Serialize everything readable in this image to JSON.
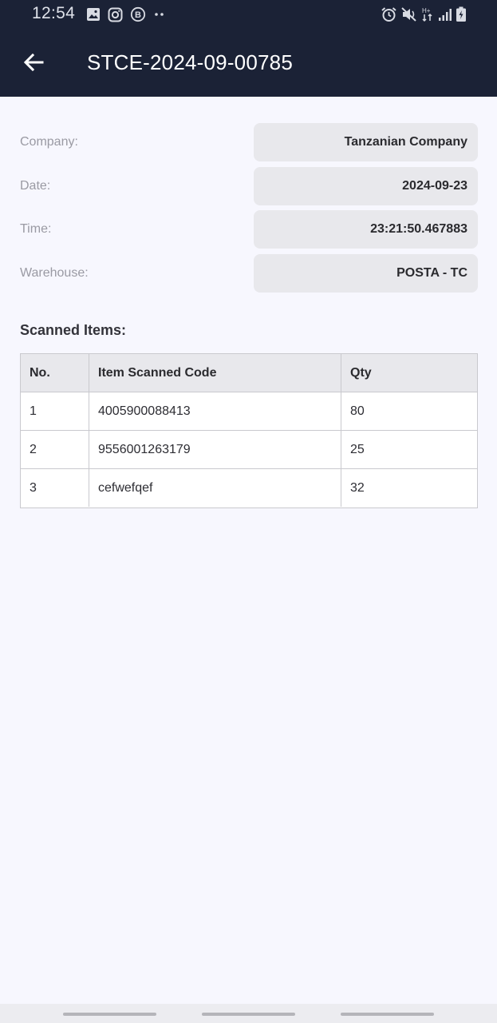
{
  "status_bar": {
    "time": "12:54",
    "left_icons": [
      "image-icon",
      "instagram-icon",
      "business-b-icon",
      "more-dots-icon"
    ],
    "right_icons": [
      "alarm-icon",
      "mute-icon",
      "data-transfer-icon",
      "signal-icon",
      "battery-icon"
    ]
  },
  "app_bar": {
    "title": "STCE-2024-09-00785",
    "back_icon": "arrow-left-icon"
  },
  "details": {
    "company_label": "Company:",
    "company_value": "Tanzanian Company",
    "date_label": "Date:",
    "date_value": "2024-09-23",
    "time_label": "Time:",
    "time_value": "23:21:50.467883",
    "warehouse_label": "Warehouse:",
    "warehouse_value": "POSTA - TC"
  },
  "scanned_items": {
    "heading": "Scanned Items:",
    "columns": [
      "No.",
      "Item Scanned Code",
      "Qty"
    ],
    "rows": [
      [
        "1",
        "4005900088413",
        "80"
      ],
      [
        "2",
        "9556001263179",
        "25"
      ],
      [
        "3",
        "cefwefqef",
        "32"
      ]
    ]
  },
  "colors": {
    "header_bg": "#1b2236",
    "page_bg": "#f7f7fe",
    "value_box_bg": "#e8e8ec"
  }
}
